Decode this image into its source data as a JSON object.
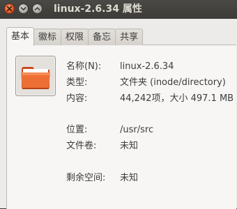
{
  "window": {
    "title": "linux-2.6.34 属性"
  },
  "tabs": [
    {
      "label": "基本"
    },
    {
      "label": "徽标"
    },
    {
      "label": "权限"
    },
    {
      "label": "备忘"
    },
    {
      "label": "共享"
    }
  ],
  "active_tab": "基本",
  "basic": {
    "name_label": "名称(N):",
    "name_value": "linux-2.6.34",
    "type_label": "类型:",
    "type_value": "文件夹 (inode/directory)",
    "contents_label": "内容:",
    "contents_value": "44,242项，大小 497.1 MB",
    "location_label": "位置:",
    "location_value": "/usr/src",
    "volume_label": "文件卷:",
    "volume_value": "未知",
    "free_label": "剩余空间:",
    "free_value": "未知"
  },
  "icons": {
    "folder": "folder-icon",
    "close": "close-icon",
    "minimize": "minimize-icon",
    "maximize": "maximize-icon"
  },
  "colors": {
    "titlebar": "#3c3b37",
    "close_button": "#e0592a",
    "folder": "#e8662e",
    "window_bg": "#edebe9"
  }
}
